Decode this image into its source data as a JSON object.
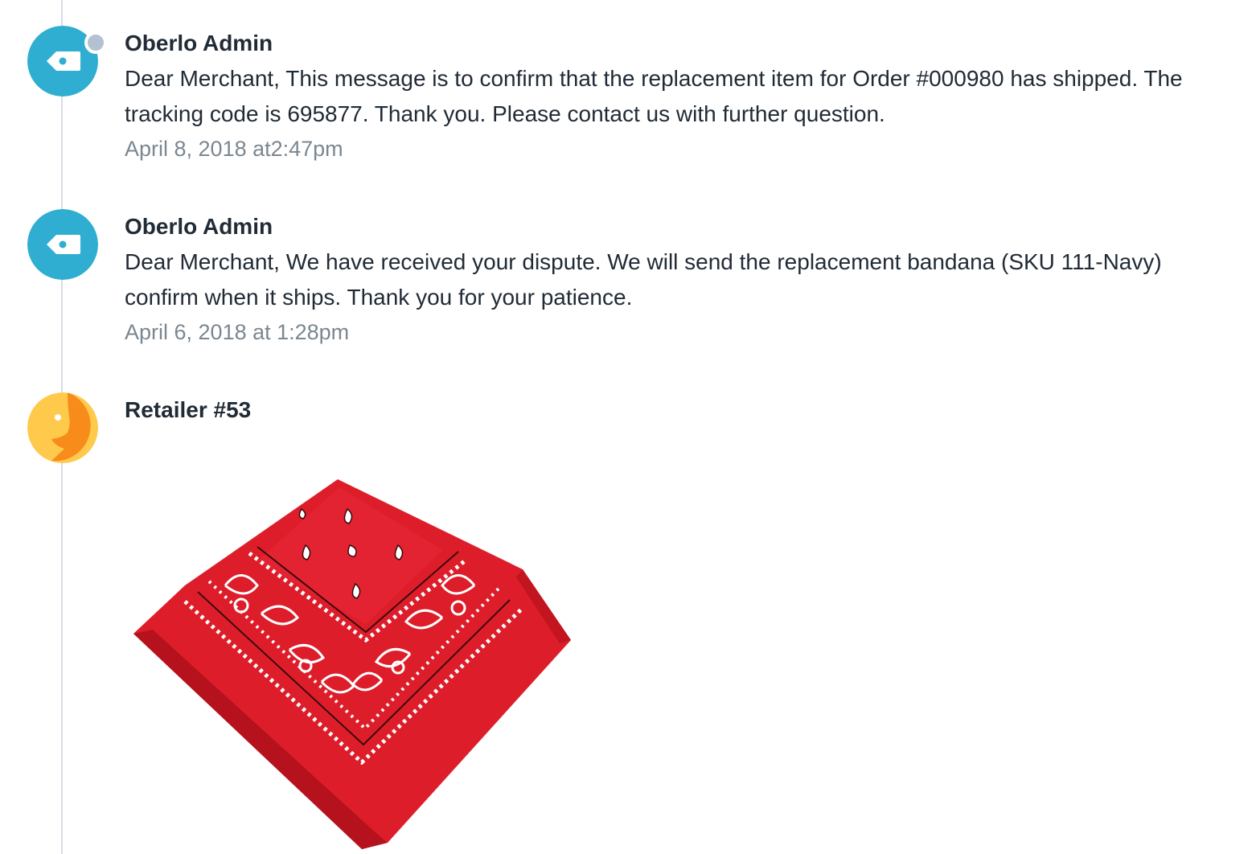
{
  "timeline": {
    "events": [
      {
        "author": "Oberlo Admin",
        "message": "Dear Merchant, This message is to confirm that the replacement item for Order #000980 has shipped. The tracking code is 695877. Thank you. Please contact us with further question.",
        "timestamp": "April 8, 2018 at2:47pm",
        "avatar_icon": "tag-icon",
        "avatar_color": "#2faed1",
        "unread": true
      },
      {
        "author": "Oberlo Admin",
        "message": "Dear Merchant, We have received your dispute. We will send the replacement bandana (SKU 111-Navy) confirm when it ships. Thank you for your patience.",
        "timestamp": "April 6, 2018 at 1:28pm",
        "avatar_icon": "tag-icon",
        "avatar_color": "#2faed1",
        "unread": false
      },
      {
        "author": "Retailer #53",
        "avatar_icon": "face-profile-icon",
        "avatar_colors": [
          "#ffc94b",
          "#f78c1a"
        ],
        "attachment": {
          "kind": "image",
          "subject": "red paisley bandana",
          "color": "#dd1e2a"
        }
      }
    ]
  },
  "colors": {
    "timeline_line": "#d7dde3",
    "author_text": "#212b36",
    "timestamp_text": "#7b8791",
    "unread_dot": "#b4c1d3"
  }
}
